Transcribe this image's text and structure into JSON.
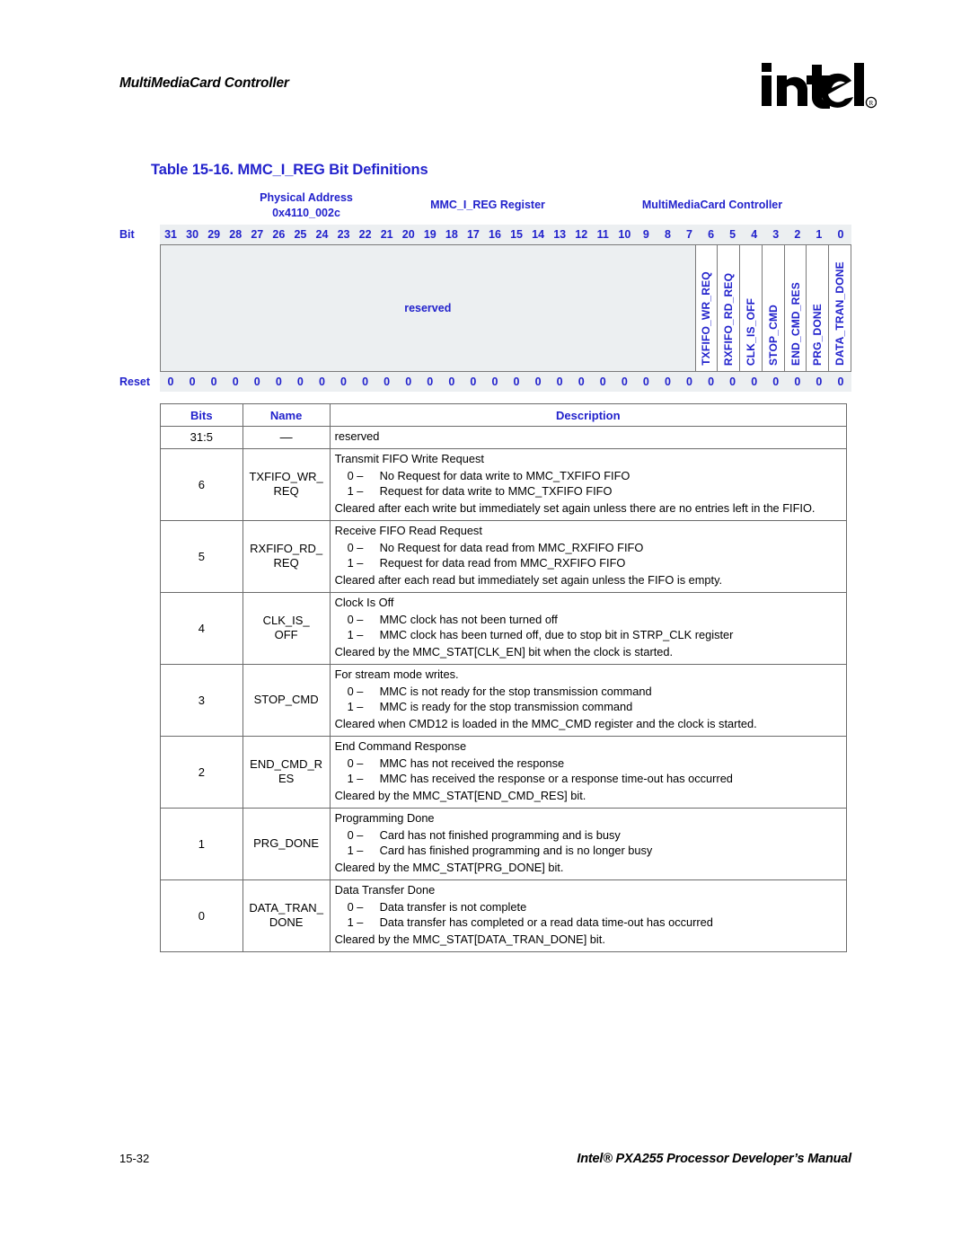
{
  "header": {
    "running_head": "MultiMediaCard Controller",
    "logo_text": "intel",
    "logo_mark": "®"
  },
  "caption": "Table 15-16. MMC_I_REG Bit Definitions",
  "register_diagram": {
    "physical_address_label": "Physical Address",
    "physical_address_value": "0x4110_002c",
    "register_name": "MMC_I_REG Register",
    "unit_name": "MultiMediaCard Controller",
    "bit_row_label": "Bit",
    "reset_row_label": "Reset",
    "bit_numbers": [
      "31",
      "30",
      "29",
      "28",
      "27",
      "26",
      "25",
      "24",
      "23",
      "22",
      "21",
      "20",
      "19",
      "18",
      "17",
      "16",
      "15",
      "14",
      "13",
      "12",
      "11",
      "10",
      "9",
      "8",
      "7",
      "6",
      "5",
      "4",
      "3",
      "2",
      "1",
      "0"
    ],
    "reset_values": [
      "0",
      "0",
      "0",
      "0",
      "0",
      "0",
      "0",
      "0",
      "0",
      "0",
      "0",
      "0",
      "0",
      "0",
      "0",
      "0",
      "0",
      "0",
      "0",
      "0",
      "0",
      "0",
      "0",
      "0",
      "0",
      "0",
      "0",
      "0",
      "0",
      "0",
      "0",
      "0"
    ],
    "reserved_label": "reserved",
    "fields": [
      {
        "name": "TXFIFO_WR_REQ"
      },
      {
        "name": "RXFIFO_RD_REQ"
      },
      {
        "name": "CLK_IS_OFF"
      },
      {
        "name": "STOP_CMD"
      },
      {
        "name": "END_CMD_RES"
      },
      {
        "name": "PRG_DONE"
      },
      {
        "name": "DATA_TRAN_DONE"
      }
    ]
  },
  "description_table": {
    "headers": {
      "bits": "Bits",
      "name": "Name",
      "description": "Description"
    },
    "rows": [
      {
        "bits": "31:5",
        "name": "—",
        "title": "reserved",
        "options": [],
        "note": ""
      },
      {
        "bits": "6",
        "name": "TXFIFO_WR_\nREQ",
        "title": "Transmit FIFO Write Request",
        "options": [
          {
            "value": "0 –",
            "text": "No Request for data write to MMC_TXFIFO FIFO"
          },
          {
            "value": "1 –",
            "text": "Request for data write to MMC_TXFIFO FIFO"
          }
        ],
        "note": "Cleared after each write but immediately set again unless there are no entries left in the FIFIO."
      },
      {
        "bits": "5",
        "name": "RXFIFO_RD_\nREQ",
        "title": "Receive FIFO Read Request",
        "options": [
          {
            "value": "0 –",
            "text": "No Request for data read from MMC_RXFIFO FIFO"
          },
          {
            "value": "1 –",
            "text": "Request for data read from MMC_RXFIFO FIFO"
          }
        ],
        "note": "Cleared after each read but immediately set again unless the FIFO is empty."
      },
      {
        "bits": "4",
        "name": "CLK_IS_\nOFF",
        "title": "Clock Is Off",
        "options": [
          {
            "value": "0 –",
            "text": "MMC clock has not been turned off"
          },
          {
            "value": "1 –",
            "text": "MMC clock has been turned off, due to stop bit in STRP_CLK register"
          }
        ],
        "note": "Cleared by the MMC_STAT[CLK_EN] bit when the clock is started."
      },
      {
        "bits": "3",
        "name": "STOP_CMD",
        "title": "For stream mode writes.",
        "options": [
          {
            "value": "0 –",
            "text": "MMC is not ready for the stop transmission command"
          },
          {
            "value": "1 –",
            "text": "MMC is ready for the stop transmission command"
          }
        ],
        "note": "Cleared when CMD12 is loaded in the MMC_CMD register and the clock is started."
      },
      {
        "bits": "2",
        "name": "END_CMD_R\nES",
        "title": "End Command Response",
        "options": [
          {
            "value": "0 –",
            "text": "MMC has not received the response"
          },
          {
            "value": "1 –",
            "text": "MMC has received the response or a response time-out has occurred"
          }
        ],
        "note": "Cleared by the MMC_STAT[END_CMD_RES] bit."
      },
      {
        "bits": "1",
        "name": "PRG_DONE",
        "title": "Programming Done",
        "options": [
          {
            "value": "0 –",
            "text": "Card has not finished programming and is busy"
          },
          {
            "value": "1 –",
            "text": "Card has finished programming and is no longer busy"
          }
        ],
        "note": "Cleared by the MMC_STAT[PRG_DONE] bit."
      },
      {
        "bits": "0",
        "name": "DATA_TRAN_\nDONE",
        "title": "Data Transfer Done",
        "options": [
          {
            "value": "0 –",
            "text": "Data transfer is not complete"
          },
          {
            "value": "1 –",
            "text": "Data transfer has completed or a read data time-out has occurred"
          }
        ],
        "note": "Cleared by the MMC_STAT[DATA_TRAN_DONE] bit."
      }
    ]
  },
  "footer": {
    "page_number": "15-32",
    "manual_title": "Intel® PXA255 Processor Developer’s Manual"
  },
  "colors": {
    "accent_blue": "#2222cc",
    "table_border": "#6b6b6b",
    "reg_fill": "#eceff1"
  }
}
